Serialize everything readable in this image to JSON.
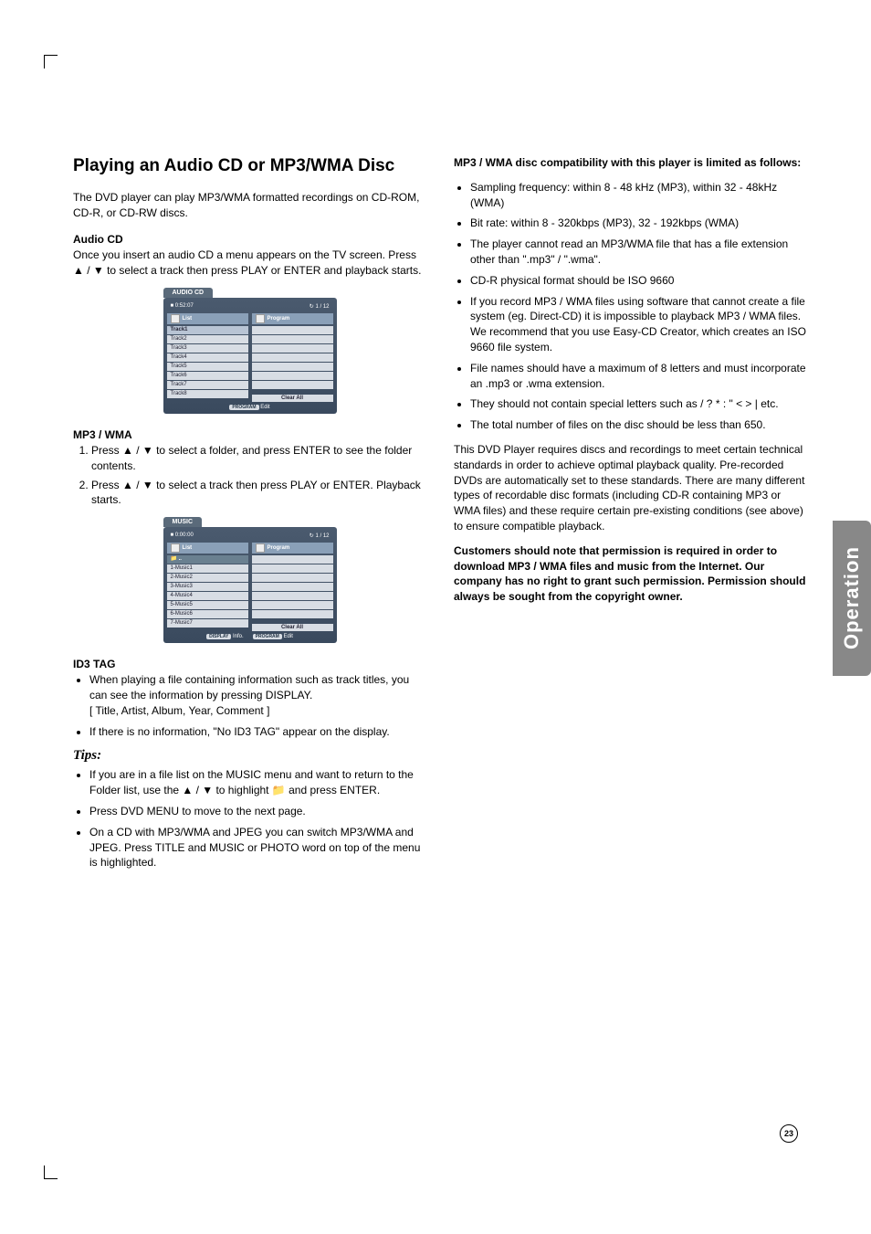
{
  "sideTab": "Operation",
  "pageNumber": "23",
  "col1": {
    "h1": "Playing an Audio CD or MP3/WMA Disc",
    "intro": "The DVD player can play MP3/WMA formatted recordings on CD-ROM, CD-R, or CD-RW discs.",
    "audioCD": {
      "head": "Audio CD",
      "body": "Once you insert an audio CD a menu appears on the TV screen. Press ▲ / ▼ to select a track then press PLAY or ENTER and playback starts."
    },
    "audioMenu": {
      "tab": "AUDIO CD",
      "time": "0:52:07",
      "count": "1 / 12",
      "listLabel": "List",
      "programLabel": "Program",
      "tracks": [
        "Track1",
        "Track2",
        "Track3",
        "Track4",
        "Track5",
        "Track6",
        "Track7",
        "Track8"
      ],
      "clearAll": "Clear All",
      "footerBtn": "PROGRAM",
      "footerTxt": "Edit"
    },
    "mp3": {
      "head": "MP3 / WMA",
      "steps": [
        "Press ▲ / ▼ to select a folder, and press ENTER to see the folder contents.",
        "Press ▲ / ▼ to select a track then press PLAY or ENTER. Playback starts."
      ]
    },
    "musicMenu": {
      "tab": "MUSIC",
      "time": "0:00:00",
      "count": "1 / 12",
      "listLabel": "List",
      "programLabel": "Program",
      "tracks": [
        "1-Music1",
        "2-Music2",
        "3-Music3",
        "4-Music4",
        "5-Music5",
        "6-Music6",
        "7-Music7"
      ],
      "clearAll": "Clear All",
      "footerBtn1": "DISPLAY",
      "footerTxt1": "Info.",
      "footerBtn2": "PROGRAM",
      "footerTxt2": "Edit"
    },
    "id3": {
      "head": "ID3 TAG",
      "bullets": [
        "When playing a file containing information such as track titles, you can see the information by pressing DISPLAY.\n[ Title, Artist, Album, Year, Comment ]",
        "If there is no information, \"No ID3 TAG\" appear on the display."
      ]
    },
    "tips": {
      "head": "Tips:",
      "bullets": [
        "If you are in a file list on the MUSIC menu and want to return to the Folder list, use the ▲ / ▼ to highlight  📁  and press ENTER.",
        "Press DVD MENU to move to the next page.",
        "On a CD with MP3/WMA and JPEG you can switch MP3/WMA and JPEG. Press TITLE and MUSIC or PHOTO word on top of the menu is highlighted."
      ]
    }
  },
  "col2": {
    "compatHead": "MP3 / WMA disc compatibility with this player is limited as follows:",
    "compatBullets": [
      "Sampling frequency: within 8 - 48 kHz (MP3), within 32 - 48kHz (WMA)",
      "Bit rate: within 8 - 320kbps (MP3), 32 - 192kbps (WMA)",
      "The player cannot read an MP3/WMA file that has a file extension other than \".mp3\" / \".wma\".",
      "CD-R physical format should be ISO 9660",
      "If you record MP3 / WMA files using software that cannot create a file system (eg. Direct-CD) it is impossible to playback MP3 / WMA files. We recommend that you use Easy-CD Creator, which creates an ISO 9660 file system.",
      "File names should have a maximum of 8 letters and must incorporate an .mp3 or .wma extension.",
      "They should not contain special letters such as  / ? * : \" < > | etc.",
      "The total number of files on the disc should be less than 650."
    ],
    "para": "This DVD Player requires discs and recordings to meet certain technical standards in order to achieve optimal playback quality. Pre-recorded DVDs are automatically set to these standards. There are many different types of recordable disc formats (including CD-R containing MP3 or WMA files) and these require certain pre-existing conditions (see above) to ensure compatible playback.",
    "notice": "Customers should note that permission is required in order to download MP3 / WMA files and music from the Internet. Our company has no right to grant such permission. Permission should always be sought from the copyright owner."
  }
}
